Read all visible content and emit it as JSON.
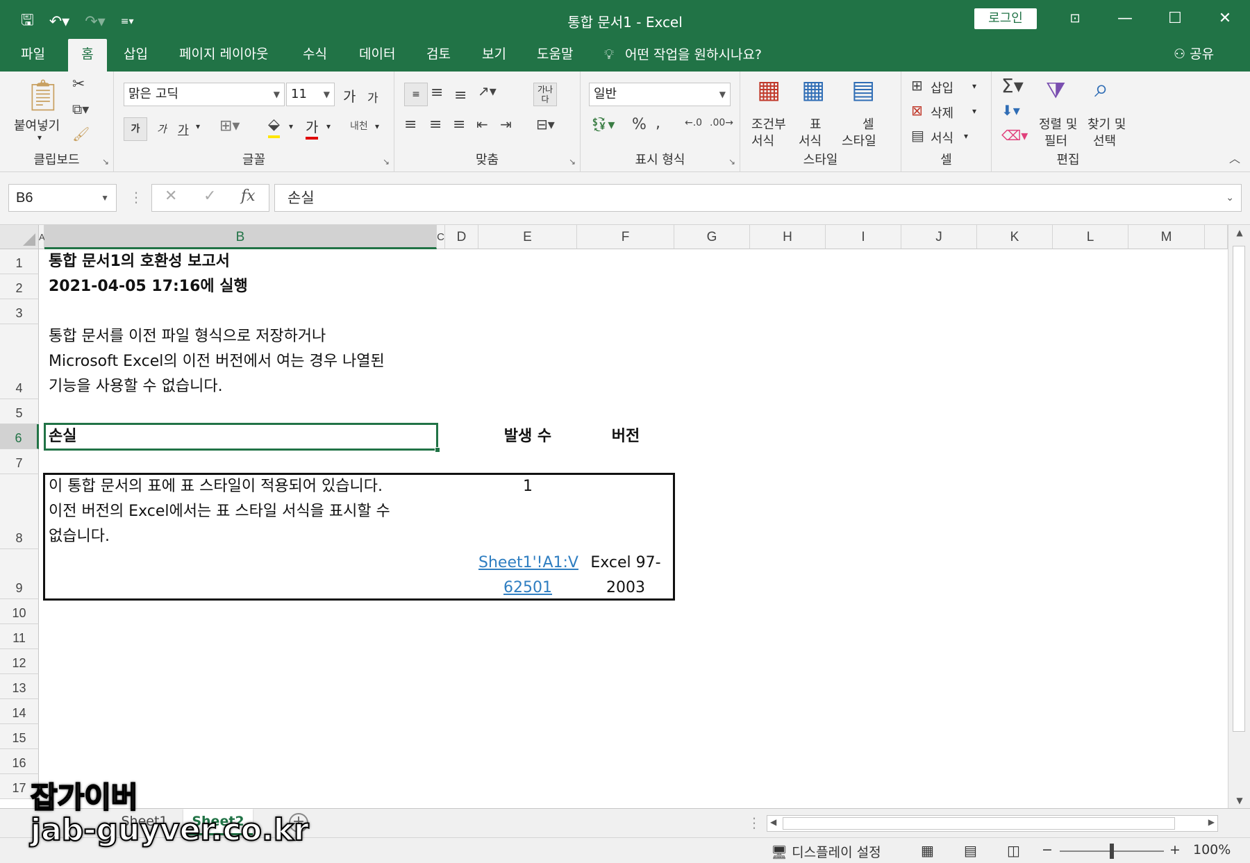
{
  "titlebar": {
    "title": "통합 문서1  -  Excel",
    "login": "로그인"
  },
  "tabs": [
    "파일",
    "홈",
    "삽입",
    "페이지 레이아웃",
    "수식",
    "데이터",
    "검토",
    "보기",
    "도움말"
  ],
  "tell_me": "어떤 작업을 원하시나요?",
  "share": "공유",
  "ribbon": {
    "clipboard": {
      "label": "클립보드",
      "paste": "붙여넣기"
    },
    "font": {
      "label": "글꼴",
      "font_name": "맑은 고딕",
      "font_size": "11",
      "bold": "가",
      "italic": "가",
      "underline": "가",
      "grow": "가",
      "shrink": "가",
      "font_color": "가",
      "phonetic": "내천"
    },
    "alignment": {
      "label": "맞춤",
      "wrap": "가나다"
    },
    "number": {
      "label": "표시 형식",
      "format": "일반"
    },
    "styles": {
      "label": "스타일",
      "cond_line1": "조건부",
      "cond_line2": "서식",
      "table_line1": "표",
      "table_line2": "서식",
      "cell_line1": "셀",
      "cell_line2": "스타일"
    },
    "cells": {
      "label": "셀",
      "insert": "삽입",
      "delete": "삭제",
      "format": "서식"
    },
    "editing": {
      "label": "편집",
      "sort_line1": "정렬 및",
      "sort_line2": "필터",
      "find_line1": "찾기 및",
      "find_line2": "선택"
    }
  },
  "formula_bar": {
    "name_box": "B6",
    "formula": "손실",
    "cancel": "✕",
    "enter": "✓",
    "fx": "fx"
  },
  "columns": [
    "A",
    "B",
    "C",
    "D",
    "E",
    "F",
    "G",
    "H",
    "I",
    "J",
    "K",
    "L",
    "M"
  ],
  "rows": [
    "1",
    "2",
    "3",
    "4",
    "5",
    "6",
    "7",
    "8",
    "9",
    "10",
    "11",
    "12",
    "13",
    "14",
    "15",
    "16",
    "17"
  ],
  "cells": {
    "b1": "통합 문서1의 호환성 보고서",
    "b2": "2021-04-05 17:16에 실행",
    "b4_line1": "통합 문서를 이전 파일 형식으로 저장하거나",
    "b4_line2": "Microsoft Excel의 이전 버전에서 여는 경우 나열된",
    "b4_line3": "기능을 사용할 수 없습니다.",
    "b6": "손실",
    "e6": "발생 수",
    "f6": "버전",
    "b8_line1": "이 통합 문서의 표에 표 스타일이 적용되어 있습니다.",
    "b8_line2": "이전 버전의 Excel에서는 표 스타일 서식을 표시할 수",
    "b8_line3": "없습니다.",
    "e8": "1",
    "e9_line1": "Sheet1'!A1:V",
    "e9_line2": "62501",
    "f9_line1": "Excel 97-",
    "f9_line2": "2003"
  },
  "sheets": [
    "Sheet1",
    "Sheet2"
  ],
  "active_sheet": "Sheet2",
  "status": {
    "display_settings": "디스플레이 설정",
    "zoom": "100%"
  },
  "watermark": {
    "line1": "잡가이버",
    "line2": "jab-guyver.co.kr"
  },
  "colors": {
    "accent": "#217346",
    "link": "#2f7ec1"
  }
}
